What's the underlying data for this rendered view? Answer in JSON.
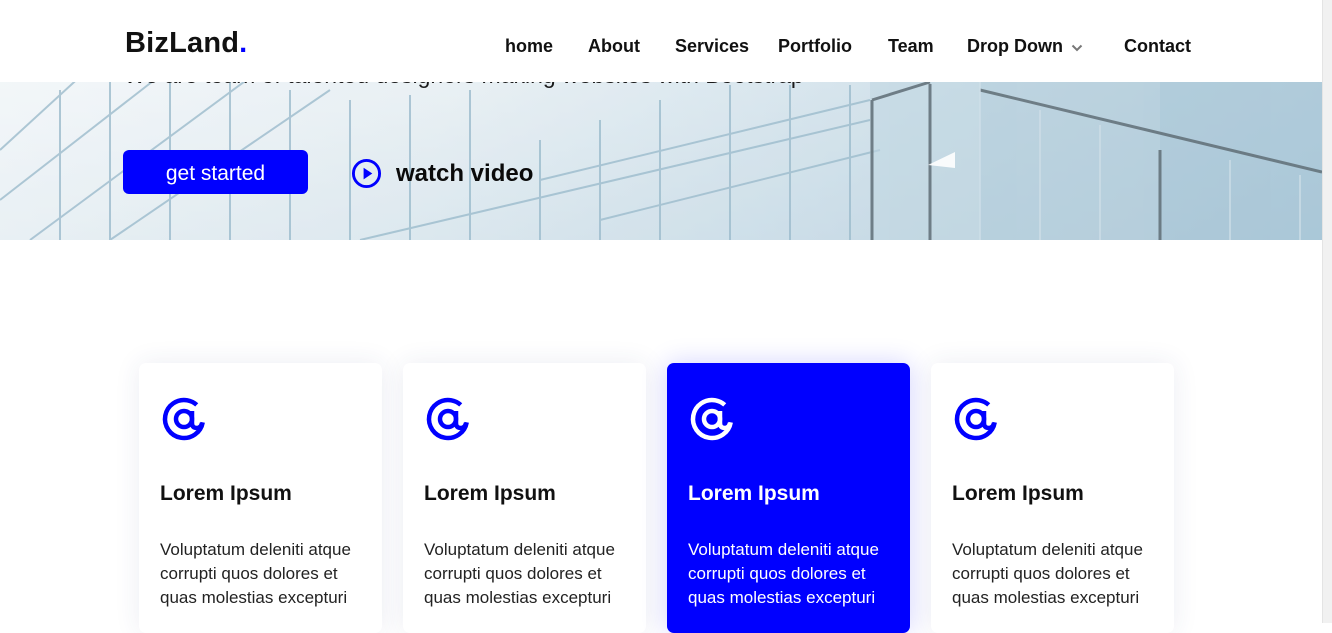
{
  "header": {
    "logo_text": "BizLand",
    "logo_dot": ".",
    "nav": [
      {
        "label": "home"
      },
      {
        "label": "About"
      },
      {
        "label": "Services"
      },
      {
        "label": "Portfolio"
      },
      {
        "label": "Team"
      },
      {
        "label": "Drop Down",
        "icon": "chevron-down-icon"
      },
      {
        "label": "Contact"
      }
    ]
  },
  "hero": {
    "tagline": "We are team of talented designers making websites with Bootstrap",
    "cta_label": "get started",
    "watch_label": "watch video",
    "watch_icon": "play-circle-icon"
  },
  "cards": [
    {
      "icon": "at-sign-icon",
      "title": "Lorem Ipsum",
      "description": "Voluptatum deleniti atque corrupti quos dolores et quas molestias excepturi",
      "active": false
    },
    {
      "icon": "at-sign-icon",
      "title": "Lorem Ipsum",
      "description": "Voluptatum deleniti atque corrupti quos dolores et quas molestias excepturi",
      "active": false
    },
    {
      "icon": "at-sign-icon",
      "title": "Lorem Ipsum",
      "description": "Voluptatum deleniti atque corrupti quos dolores et quas molestias excepturi",
      "active": true
    },
    {
      "icon": "at-sign-icon",
      "title": "Lorem Ipsum",
      "description": "Voluptatum deleniti atque corrupti quos dolores et quas molestias excepturi",
      "active": false
    }
  ],
  "colors": {
    "accent": "#0000ff",
    "text": "#111111",
    "background": "#ffffff"
  }
}
